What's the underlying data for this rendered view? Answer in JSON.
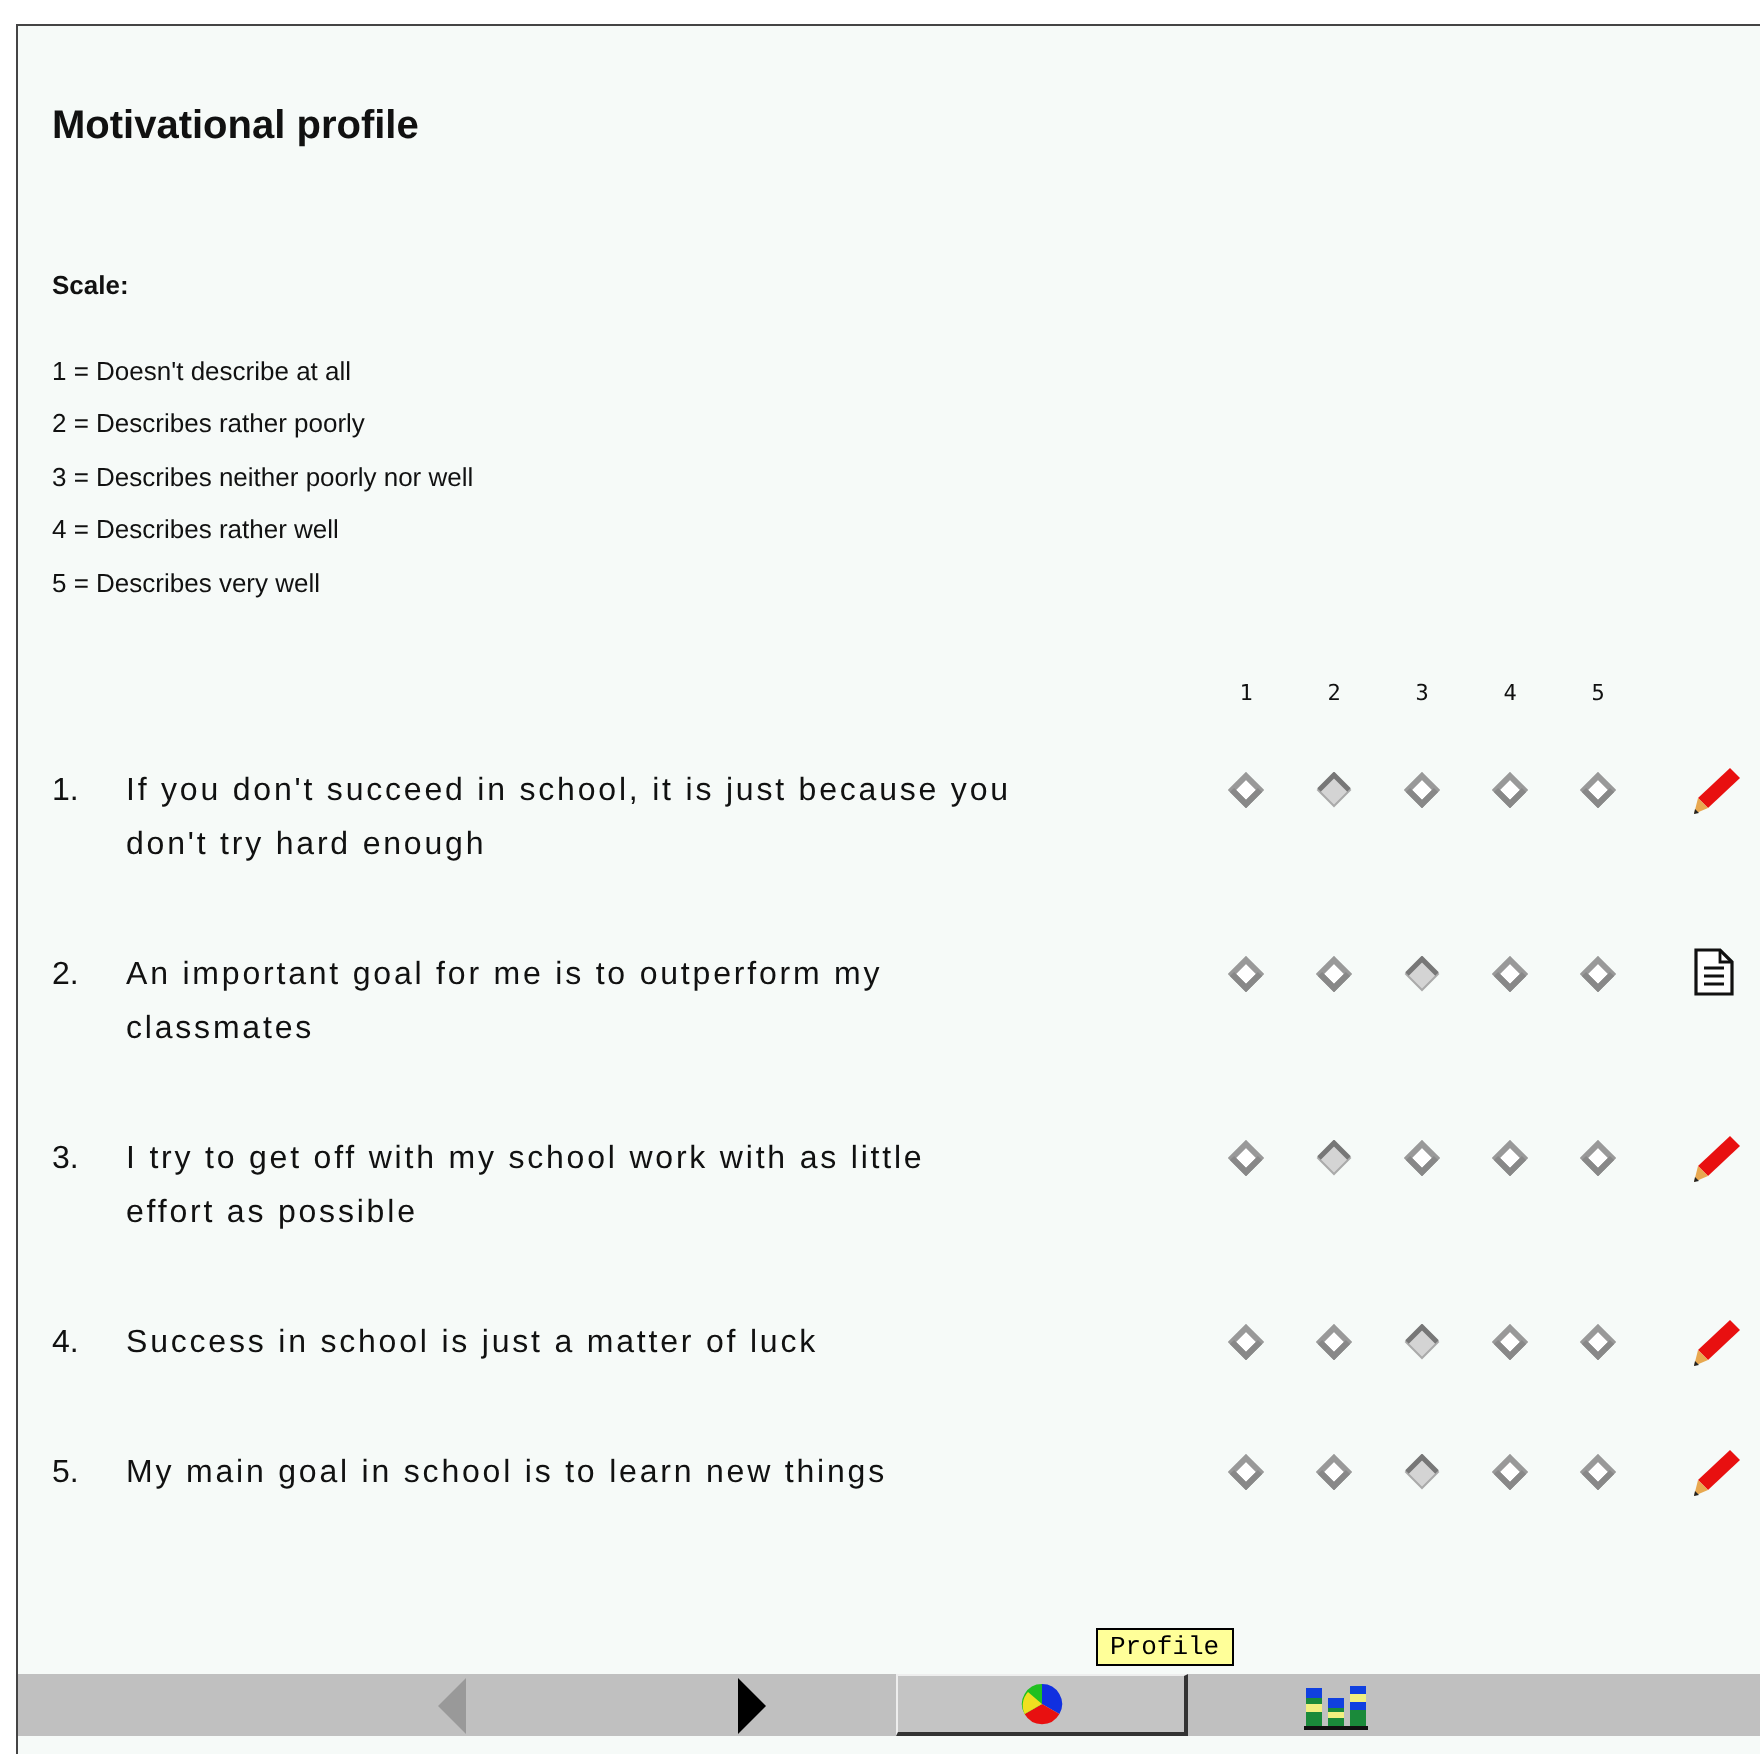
{
  "title": "Motivational profile",
  "scale": {
    "heading": "Scale:",
    "lines": [
      "1 = Doesn't describe at all",
      "2 = Describes rather poorly",
      "3 = Describes neither poorly nor well",
      "4 = Describes rather well",
      "5 = Describes very well"
    ]
  },
  "columns": [
    "1",
    "2",
    "3",
    "4",
    "5"
  ],
  "items": [
    {
      "number": "1.",
      "text": "If you don't succeed in school, it is just because you don't try hard enough",
      "ratings": [
        {
          "selected": false
        },
        {
          "selected": true
        },
        {
          "selected": false
        },
        {
          "selected": false
        },
        {
          "selected": false
        }
      ],
      "kind": "pencil"
    },
    {
      "number": "2.",
      "text": "An important goal for me is to outperform my classmates",
      "ratings": [
        {
          "selected": false
        },
        {
          "selected": false
        },
        {
          "selected": true
        },
        {
          "selected": false
        },
        {
          "selected": false
        }
      ],
      "kind": "note"
    },
    {
      "number": "3.",
      "text": "I try to get off with my school work with as little effort as possible",
      "ratings": [
        {
          "selected": false
        },
        {
          "selected": true
        },
        {
          "selected": false
        },
        {
          "selected": false
        },
        {
          "selected": false
        }
      ],
      "kind": "pencil"
    },
    {
      "number": "4.",
      "text": "Success in school is just a matter of luck",
      "ratings": [
        {
          "selected": false
        },
        {
          "selected": false
        },
        {
          "selected": true
        },
        {
          "selected": false
        },
        {
          "selected": false
        }
      ],
      "kind": "pencil"
    },
    {
      "number": "5.",
      "text": "My main goal in school is to learn new things",
      "ratings": [
        {
          "selected": false
        },
        {
          "selected": false
        },
        {
          "selected": true
        },
        {
          "selected": false
        },
        {
          "selected": false
        }
      ],
      "kind": "pencil"
    }
  ],
  "toolbar": {
    "previous": {
      "disabled": true
    },
    "next": {
      "disabled": false
    },
    "profile": {
      "selected": true,
      "tooltip": "Profile"
    },
    "chart": {
      "selected": false
    }
  }
}
